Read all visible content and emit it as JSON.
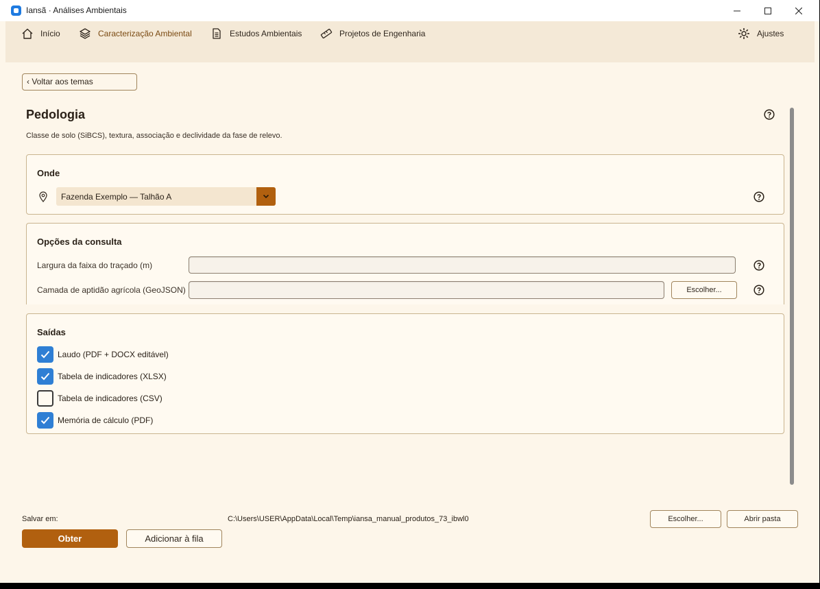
{
  "window": {
    "title": "Iansã · Análises Ambientais"
  },
  "nav": {
    "items": [
      {
        "label": "Início",
        "icon": "home-icon"
      },
      {
        "label": "Caracterização Ambiental",
        "icon": "layers-icon"
      },
      {
        "label": "Estudos Ambientais",
        "icon": "document-icon"
      },
      {
        "label": "Projetos de Engenharia",
        "icon": "ruler-icon"
      }
    ],
    "settings_label": "Ajustes"
  },
  "back_label": "‹ Voltar aos temas",
  "page": {
    "title": "Pedologia",
    "description": "Classe de solo (SiBCS), textura, associação e declividade da fase de relevo."
  },
  "where": {
    "title": "Onde",
    "selected": "Fazenda Exemplo — Talhão A"
  },
  "options": {
    "title": "Opções da consulta",
    "width_label": "Largura da faixa do traçado (m)",
    "width_value": "",
    "layer_label": "Camada de aptidão agrícola (GeoJSON)",
    "layer_value": "",
    "choose_label": "Escolher..."
  },
  "outputs": {
    "title": "Saídas",
    "items": [
      {
        "label": "Laudo (PDF + DOCX editável)",
        "checked": true
      },
      {
        "label": "Tabela de indicadores (XLSX)",
        "checked": true
      },
      {
        "label": "Tabela de indicadores (CSV)",
        "checked": false
      },
      {
        "label": "Memória de cálculo (PDF)",
        "checked": true
      }
    ]
  },
  "footer": {
    "save_label": "Salvar em:",
    "save_path": "C:\\Users\\USER\\AppData\\Local\\Temp\\iansa_manual_produtos_73_ibwl0",
    "choose_label": "Escolher...",
    "open_folder_label": "Abrir pasta",
    "get_label": "Obter",
    "queue_label": "Adicionar à fila"
  },
  "colors": {
    "accent": "#b1600f",
    "checkbox": "#2f7fd4",
    "background": "#fdf6ea",
    "nav_background": "#f4e9d7"
  }
}
